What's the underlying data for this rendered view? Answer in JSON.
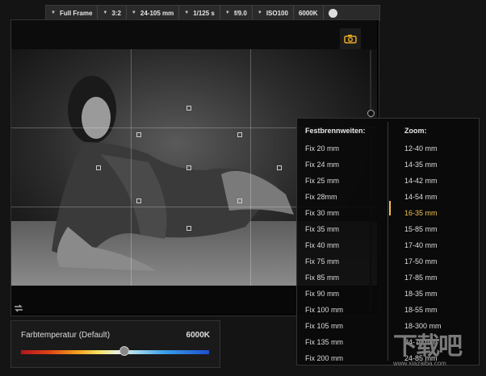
{
  "topbar": {
    "items": [
      "Full Frame",
      "3:2",
      "24-105 mm",
      "1/125 s",
      "f/9.0",
      "ISO100",
      "6000K"
    ]
  },
  "temperature": {
    "label": "Farbtemperatur (Default)",
    "value": "6000K",
    "slider_fraction": 0.55
  },
  "lens_menu": {
    "fixed_header": "Festbrennweiten:",
    "zoom_header": "Zoom:",
    "fixed": [
      "Fix 20 mm",
      "Fix 24 mm",
      "Fix 25 mm",
      "Fix 28mm",
      "Fix 30 mm",
      "Fix 35 mm",
      "Fix 40 mm",
      "Fix 75 mm",
      "Fix 85 mm",
      "Fix 90 mm",
      "Fix 100 mm",
      "Fix 105 mm",
      "Fix 135 mm",
      "Fix 200 mm"
    ],
    "zoom": [
      "12-40 mm",
      "14-35 mm",
      "14-42 mm",
      "14-54 mm",
      "16-35 mm",
      "15-85 mm",
      "17-40 mm",
      "17-50 mm",
      "17-85 mm",
      "18-35 mm",
      "18-55 mm",
      "18-300 mm",
      "24-70 mm",
      "24-85 mm"
    ],
    "selected_zoom": "16-35 mm",
    "accent_color": "#f2c14e"
  },
  "icons": [
    "camera-icon",
    "camera-icon",
    "swap-icon",
    "chevron-down-icon",
    "lens-icon"
  ],
  "watermark": {
    "text": "下载吧",
    "url": "www.xiazaiba.com"
  }
}
